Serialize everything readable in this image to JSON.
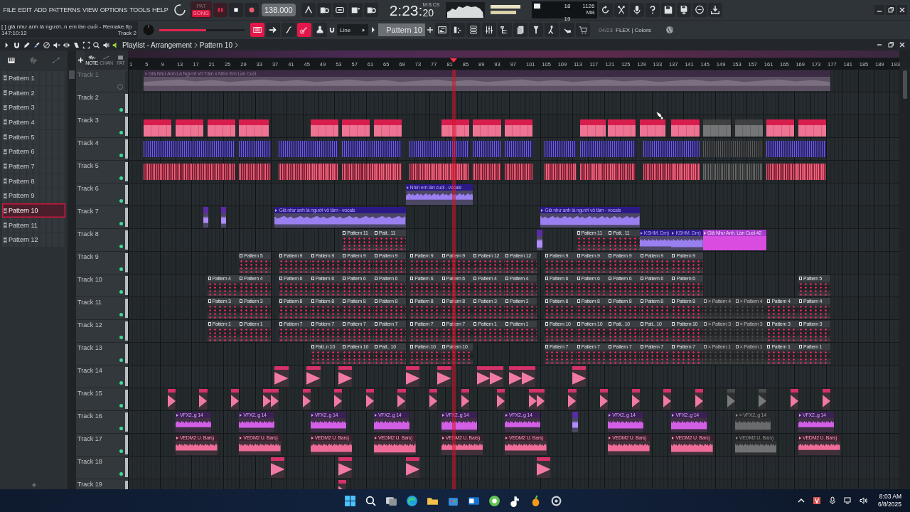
{
  "menu": [
    "FILE",
    "EDIT",
    "ADD",
    "PATTERNS",
    "VIEW",
    "OPTIONS",
    "TOOLS",
    "HELP"
  ],
  "transport": {
    "pat_label": "PAT",
    "song_label": "SONG",
    "song_mode": true,
    "tempo": "138.000"
  },
  "time": {
    "main": "2:23:",
    "cs": "20",
    "unit": "M:S:CS"
  },
  "cpu": {
    "voices": "18",
    "memory": "1126 MB",
    "polyphony": "19"
  },
  "project": {
    "title": "[ ] giả như anh là người..n em lần cuối - Remake.flp",
    "position": "147:10:12",
    "hint": "Track 2"
  },
  "master_volume": {
    "level": 0.55
  },
  "snap": "Line",
  "pattern_selector": "Pattern 10",
  "news": {
    "date": "04/23",
    "text": "FLEX | Colors"
  },
  "playlist": {
    "title": "Playlist - Arrangement",
    "pattern": "Pattern 10",
    "sidebar_tabs": [
      {
        "label": "NOTE",
        "selected": true
      },
      {
        "label": "CHAN",
        "selected": false
      },
      {
        "label": "PAT",
        "selected": false
      }
    ],
    "patterns": [
      {
        "name": "Pattern 1",
        "selected": false
      },
      {
        "name": "Pattern 2",
        "selected": false
      },
      {
        "name": "Pattern 3",
        "selected": false
      },
      {
        "name": "Pattern 4",
        "selected": false
      },
      {
        "name": "Pattern 5",
        "selected": false
      },
      {
        "name": "Pattern 6",
        "selected": false
      },
      {
        "name": "Pattern 7",
        "selected": false
      },
      {
        "name": "Pattern 8",
        "selected": false
      },
      {
        "name": "Pattern 9",
        "selected": false
      },
      {
        "name": "Pattern 10",
        "selected": true
      },
      {
        "name": "Pattern 11",
        "selected": false
      },
      {
        "name": "Pattern 12",
        "selected": false
      }
    ],
    "ruler": [
      "1",
      "5",
      "9",
      "13",
      "17",
      "21",
      "25",
      "29",
      "33",
      "37",
      "41",
      "45",
      "49",
      "53",
      "57",
      "61",
      "65",
      "69",
      "73",
      "77",
      "81",
      "85",
      "89",
      "93",
      "97",
      "101",
      "105",
      "109",
      "113",
      "117",
      "121",
      "125",
      "129",
      "133",
      "137",
      "141",
      "145",
      "149",
      "153",
      "157",
      "161",
      "165",
      "169",
      "173",
      "177",
      "181",
      "185",
      "189",
      "193"
    ],
    "tracks": [
      {
        "name": "Track 1",
        "enabled": false,
        "clips": [
          {
            "kind": "audio",
            "label": "× Giả Như Anh Là Người Vô Tâm x Nhìn Em Lần Cuối",
            "muted": false
          }
        ]
      },
      {
        "name": "Track 2",
        "enabled": true
      },
      {
        "name": "Track 3",
        "enabled": true,
        "clips": [
          {
            "kind": "block",
            "muted": false
          },
          {
            "kind": "block",
            "muted": false
          },
          {
            "kind": "block",
            "muted": false
          },
          {
            "kind": "block",
            "muted": false
          },
          {
            "kind": "block",
            "muted": false
          },
          {
            "kind": "block",
            "muted": false
          },
          {
            "kind": "block",
            "muted": false
          },
          {
            "kind": "block",
            "muted": false
          },
          {
            "kind": "block",
            "muted": false
          },
          {
            "kind": "block",
            "muted": false
          },
          {
            "kind": "block",
            "muted": false
          },
          {
            "kind": "block",
            "muted": false
          },
          {
            "kind": "block",
            "muted": false
          },
          {
            "kind": "block",
            "muted": false
          },
          {
            "kind": "block",
            "muted": true
          },
          {
            "kind": "block",
            "muted": true
          },
          {
            "kind": "block",
            "muted": false
          },
          {
            "kind": "block",
            "muted": false
          }
        ]
      },
      {
        "name": "Track 4",
        "enabled": true,
        "clips": [
          {
            "kind": "notes",
            "muted": false
          },
          {
            "kind": "notes",
            "muted": false
          },
          {
            "kind": "notes",
            "muted": false
          },
          {
            "kind": "notes",
            "muted": false
          },
          {
            "kind": "notes",
            "muted": false
          },
          {
            "kind": "notes",
            "muted": false
          },
          {
            "kind": "notes",
            "muted": false
          },
          {
            "kind": "notes",
            "muted": false
          },
          {
            "kind": "notes",
            "muted": false
          },
          {
            "kind": "notes",
            "muted": false
          },
          {
            "kind": "notes",
            "muted": true
          },
          {
            "kind": "notes",
            "muted": false
          }
        ]
      },
      {
        "name": "Track 5",
        "enabled": true,
        "clips": [
          {
            "kind": "drums",
            "muted": false
          },
          {
            "kind": "drums",
            "muted": false
          },
          {
            "kind": "drums",
            "muted": false
          },
          {
            "kind": "drums",
            "muted": false
          },
          {
            "kind": "drums",
            "muted": false
          },
          {
            "kind": "drums",
            "muted": false
          },
          {
            "kind": "drums",
            "muted": false
          },
          {
            "kind": "drums",
            "muted": false
          },
          {
            "kind": "drums",
            "muted": false
          },
          {
            "kind": "drums",
            "muted": false
          },
          {
            "kind": "drums",
            "muted": true
          },
          {
            "kind": "drums",
            "muted": false
          }
        ]
      },
      {
        "name": "Track 6",
        "enabled": true,
        "clips": [
          {
            "kind": "vocal",
            "label": "Nhìn em lần cuối - vocals",
            "muted": false
          }
        ]
      },
      {
        "name": "Track 7",
        "enabled": true,
        "clips": [
          {
            "kind": "blip",
            "muted": false
          },
          {
            "kind": "blip",
            "muted": false
          },
          {
            "kind": "vocal",
            "label": "Giả như anh là người vô tâm - vocals",
            "muted": false
          },
          {
            "kind": "vocal",
            "label": "Giả như anh là người vô tâm - vocals",
            "muted": false
          }
        ]
      },
      {
        "name": "Track 8",
        "enabled": true,
        "clips": [
          {
            "kind": "ref",
            "label": "Pattern 11",
            "muted": false
          },
          {
            "kind": "ref",
            "label": "Patt.. 11",
            "muted": false
          },
          {
            "kind": "blip",
            "muted": false
          },
          {
            "kind": "ref",
            "label": "Pattern 11",
            "muted": false
          },
          {
            "kind": "ref",
            "label": "Patt.. 11",
            "muted": false
          },
          {
            "kind": "vocal",
            "label": "KSHM. Dm)",
            "muted": false
          },
          {
            "kind": "vocal",
            "label": "KSHM. Dm)",
            "muted": false
          },
          {
            "kind": "solid",
            "label": "Giả Như Anh. Lần Cuối #2",
            "muted": false
          }
        ]
      },
      {
        "name": "Track 9",
        "enabled": true,
        "clips": [
          {
            "kind": "ref",
            "label": "Pattern 5",
            "muted": false
          },
          {
            "kind": "ref",
            "label": "Pattern 9",
            "muted": false
          },
          {
            "kind": "ref",
            "label": "Pattern 9",
            "muted": false
          },
          {
            "kind": "ref",
            "label": "Pattern 9",
            "muted": false
          },
          {
            "kind": "ref",
            "label": "Pattern 9",
            "muted": false
          },
          {
            "kind": "ref",
            "label": "Pattern 9",
            "muted": false
          },
          {
            "kind": "ref",
            "label": "Pattern 9",
            "muted": false
          },
          {
            "kind": "ref",
            "label": "Pattern 12",
            "muted": false
          },
          {
            "kind": "ref",
            "label": "Pattern 12",
            "muted": false
          },
          {
            "kind": "ref",
            "label": "Pattern 9",
            "muted": false
          },
          {
            "kind": "ref",
            "label": "Pattern 9",
            "muted": false
          },
          {
            "kind": "ref",
            "label": "Pattern 9",
            "muted": false
          },
          {
            "kind": "ref",
            "label": "Pattern 9",
            "muted": false
          },
          {
            "kind": "ref",
            "label": "Pattern 9",
            "muted": false
          }
        ]
      },
      {
        "name": "Track 10",
        "enabled": true,
        "clips": [
          {
            "kind": "ref",
            "label": "Pattern 4",
            "muted": false
          },
          {
            "kind": "ref",
            "label": "Pattern 4",
            "muted": false
          },
          {
            "kind": "ref",
            "label": "Pattern 6",
            "muted": false
          },
          {
            "kind": "ref",
            "label": "Pattern 6",
            "muted": false
          },
          {
            "kind": "ref",
            "label": "Pattern 6",
            "muted": false
          },
          {
            "kind": "ref",
            "label": "Pattern 6",
            "muted": false
          },
          {
            "kind": "ref",
            "label": "Pattern 6",
            "muted": false
          },
          {
            "kind": "ref",
            "label": "Pattern 6",
            "muted": false
          },
          {
            "kind": "ref",
            "label": "Pattern 4",
            "muted": false
          },
          {
            "kind": "ref",
            "label": "Pattern 4",
            "muted": false
          },
          {
            "kind": "ref",
            "label": "Pattern 6",
            "muted": false
          },
          {
            "kind": "ref",
            "label": "Pattern 6",
            "muted": false
          },
          {
            "kind": "ref",
            "label": "Pattern 6",
            "muted": false
          },
          {
            "kind": "ref",
            "label": "Pattern 6",
            "muted": false
          },
          {
            "kind": "ref",
            "label": "Pattern 6",
            "muted": false
          },
          {
            "kind": "ref",
            "label": "Pattern 5",
            "muted": false
          }
        ]
      },
      {
        "name": "Track 11",
        "enabled": true,
        "clips": [
          {
            "kind": "ref",
            "label": "Pattern 3",
            "muted": false
          },
          {
            "kind": "ref",
            "label": "Pattern 3",
            "muted": false
          },
          {
            "kind": "ref",
            "label": "Pattern 8",
            "muted": false
          },
          {
            "kind": "ref",
            "label": "Pattern 8",
            "muted": false
          },
          {
            "kind": "ref",
            "label": "Pattern 8",
            "muted": false
          },
          {
            "kind": "ref",
            "label": "Pattern 8",
            "muted": false
          },
          {
            "kind": "ref",
            "label": "Pattern 8",
            "muted": false
          },
          {
            "kind": "ref",
            "label": "Pattern 8",
            "muted": false
          },
          {
            "kind": "ref",
            "label": "Pattern 3",
            "muted": false
          },
          {
            "kind": "ref",
            "label": "Pattern 3",
            "muted": false
          },
          {
            "kind": "ref",
            "label": "Pattern 8",
            "muted": false
          },
          {
            "kind": "ref",
            "label": "Pattern 8",
            "muted": false
          },
          {
            "kind": "ref",
            "label": "Pattern 8",
            "muted": false
          },
          {
            "kind": "ref",
            "label": "Pattern 8",
            "muted": false
          },
          {
            "kind": "ref",
            "label": "Pattern 8",
            "muted": false
          },
          {
            "kind": "ref",
            "label": "× Pattern 4",
            "muted": true
          },
          {
            "kind": "ref",
            "label": "× Pattern 4",
            "muted": true
          },
          {
            "kind": "ref",
            "label": "Pattern 4",
            "muted": false
          },
          {
            "kind": "ref",
            "label": "Pattern 4",
            "muted": false
          }
        ]
      },
      {
        "name": "Track 12",
        "enabled": true,
        "clips": [
          {
            "kind": "ref",
            "label": "Pattern 1",
            "muted": false
          },
          {
            "kind": "ref",
            "label": "Pattern 1",
            "muted": false
          },
          {
            "kind": "ref",
            "label": "Pattern 7",
            "muted": false
          },
          {
            "kind": "ref",
            "label": "Pattern 7",
            "muted": false
          },
          {
            "kind": "ref",
            "label": "Pattern 7",
            "muted": false
          },
          {
            "kind": "ref",
            "label": "Pattern 7",
            "muted": false
          },
          {
            "kind": "ref",
            "label": "Pattern 7",
            "muted": false
          },
          {
            "kind": "ref",
            "label": "Pattern 7",
            "muted": false
          },
          {
            "kind": "ref",
            "label": "Pattern 1",
            "muted": false
          },
          {
            "kind": "ref",
            "label": "Pattern 1",
            "muted": false
          },
          {
            "kind": "ref",
            "label": "Pattern 10",
            "muted": false
          },
          {
            "kind": "ref",
            "label": "Pattern 10",
            "muted": false
          },
          {
            "kind": "ref",
            "label": "Patt.. 10",
            "muted": false
          },
          {
            "kind": "ref",
            "label": "Patt.. 10",
            "muted": false
          },
          {
            "kind": "ref",
            "label": "Pattern 10",
            "muted": false
          },
          {
            "kind": "ref",
            "label": "× Pattern 3",
            "muted": true
          },
          {
            "kind": "ref",
            "label": "× Pattern 3",
            "muted": true
          },
          {
            "kind": "ref",
            "label": "Pattern 3",
            "muted": false
          },
          {
            "kind": "ref",
            "label": "Pattern 3",
            "muted": false
          }
        ]
      },
      {
        "name": "Track 13",
        "enabled": true,
        "clips": [
          {
            "kind": "ref",
            "label": "Patt..n 10",
            "muted": false
          },
          {
            "kind": "ref",
            "label": "Pattern 10",
            "muted": false
          },
          {
            "kind": "ref",
            "label": "Patt.. 10",
            "muted": false
          },
          {
            "kind": "ref",
            "label": "Pattern 10",
            "muted": false
          },
          {
            "kind": "ref",
            "label": "Pattern 10",
            "muted": false
          },
          {
            "kind": "ref",
            "label": "Pattern 7",
            "muted": false
          },
          {
            "kind": "ref",
            "label": "Pattern 7",
            "muted": false
          },
          {
            "kind": "ref",
            "label": "Pattern 7",
            "muted": false
          },
          {
            "kind": "ref",
            "label": "Pattern 7",
            "muted": false
          },
          {
            "kind": "ref",
            "label": "Pattern 7",
            "muted": false
          },
          {
            "kind": "ref",
            "label": "× Pattern 1",
            "muted": true
          },
          {
            "kind": "ref",
            "label": "× Pattern 1",
            "muted": true
          },
          {
            "kind": "ref",
            "label": "Pattern 1",
            "muted": false
          },
          {
            "kind": "ref",
            "label": "Pattern 1",
            "muted": false
          }
        ]
      },
      {
        "name": "Track 14",
        "enabled": true,
        "clips": [
          {
            "kind": "sample",
            "muted": false
          },
          {
            "kind": "sample",
            "muted": false
          },
          {
            "kind": "sample",
            "muted": false
          },
          {
            "kind": "sample",
            "muted": false
          },
          {
            "kind": "sample",
            "muted": false
          },
          {
            "kind": "sample",
            "muted": false
          },
          {
            "kind": "sample",
            "muted": false
          },
          {
            "kind": "sample",
            "muted": false
          },
          {
            "kind": "sample",
            "muted": false
          },
          {
            "kind": "sample",
            "muted": false
          }
        ]
      },
      {
        "name": "Track 15",
        "enabled": true,
        "clips": [
          {
            "kind": "sample",
            "muted": false
          },
          {
            "kind": "sample",
            "muted": false
          },
          {
            "kind": "sample",
            "muted": false
          },
          {
            "kind": "sample",
            "muted": false
          },
          {
            "kind": "sample",
            "muted": false
          },
          {
            "kind": "sample",
            "muted": false
          },
          {
            "kind": "sample",
            "muted": false
          },
          {
            "kind": "sample",
            "muted": false
          },
          {
            "kind": "sample",
            "muted": false
          },
          {
            "kind": "sample",
            "muted": false
          },
          {
            "kind": "sample",
            "muted": false
          },
          {
            "kind": "sample",
            "muted": false
          },
          {
            "kind": "sample",
            "muted": false
          },
          {
            "kind": "sample",
            "muted": false
          },
          {
            "kind": "sample",
            "muted": false
          },
          {
            "kind": "sample",
            "muted": false
          },
          {
            "kind": "sample",
            "muted": false
          },
          {
            "kind": "sample",
            "muted": false
          },
          {
            "kind": "sample",
            "muted": false
          },
          {
            "kind": "sample",
            "muted": true
          },
          {
            "kind": "sample",
            "muted": true
          },
          {
            "kind": "sample",
            "muted": false
          },
          {
            "kind": "sample",
            "muted": false
          }
        ]
      },
      {
        "name": "Track 16",
        "enabled": true,
        "clips": [
          {
            "kind": "vfx",
            "label": "VFX2..g 14",
            "muted": false
          },
          {
            "kind": "vfx",
            "label": "VFX2..g 14",
            "muted": false
          },
          {
            "kind": "vfx",
            "label": "VFX2..g 14",
            "muted": false
          },
          {
            "kind": "vfx",
            "label": "VFX2..g 14",
            "muted": false
          },
          {
            "kind": "vfx",
            "label": "VFX2..g 14",
            "muted": false
          },
          {
            "kind": "vfx",
            "label": "VFX2..g 14",
            "muted": false
          },
          {
            "kind": "blip",
            "muted": false
          },
          {
            "kind": "vfx",
            "label": "VFX2..g 14",
            "muted": false
          },
          {
            "kind": "vfx",
            "label": "VFX2..g 14",
            "muted": false
          },
          {
            "kind": "vfx",
            "label": "× VFX2..g 14",
            "muted": true
          },
          {
            "kind": "vfx",
            "label": "VFX2..g 14",
            "muted": false
          }
        ]
      },
      {
        "name": "Track 17",
        "enabled": true,
        "clips": [
          {
            "kind": "edm",
            "label": "VEDM2 U. Bars)",
            "muted": false
          },
          {
            "kind": "edm",
            "label": "VEDM2 U. Bars)",
            "muted": false
          },
          {
            "kind": "edm",
            "label": "VEDM2 U. Bars)",
            "muted": false
          },
          {
            "kind": "edm",
            "label": "VEDM2 U. Bars)",
            "muted": false
          },
          {
            "kind": "edm",
            "label": "VEDM2 U. Bars)",
            "muted": false
          },
          {
            "kind": "edm",
            "label": "VEDM2 U. Bars)",
            "muted": false
          },
          {
            "kind": "edm",
            "label": "VEDM2 U. Bars)",
            "muted": false
          },
          {
            "kind": "edm",
            "label": "VEDM2 U. Bars)",
            "muted": false
          },
          {
            "kind": "edm",
            "label": "VEDM2 U. Bars)",
            "muted": true
          },
          {
            "kind": "edm",
            "label": "VEDM2 U. Bars)",
            "muted": false
          }
        ]
      },
      {
        "name": "Track 18",
        "enabled": true,
        "clips": [
          {
            "kind": "sample",
            "muted": false
          },
          {
            "kind": "sample",
            "muted": false
          },
          {
            "kind": "sample",
            "muted": false
          },
          {
            "kind": "sample",
            "muted": false
          }
        ]
      },
      {
        "name": "Track 19",
        "enabled": true,
        "clips": [
          {
            "kind": "sample",
            "muted": false
          }
        ]
      }
    ]
  },
  "taskbar": {
    "time": "8:03 AM",
    "date": "6/8/2025"
  }
}
